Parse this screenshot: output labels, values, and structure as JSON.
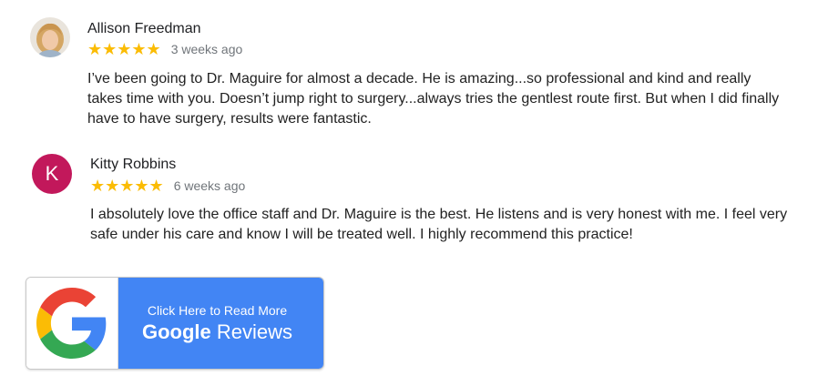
{
  "reviews": [
    {
      "name": "Allison Freedman",
      "stars": "★★★★★",
      "time": "3 weeks ago",
      "text": "I’ve been going to Dr. Maguire for almost a decade. He is amazing...so professional and kind and really takes time with you. Doesn’t jump right to surgery...always tries the gentlest route first. But when I did finally have to have surgery, results were fantastic.",
      "avatar_type": "photo"
    },
    {
      "name": "Kitty Robbins",
      "stars": "★★★★★",
      "time": "6 weeks ago",
      "text": "I absolutely love the office staff and Dr. Maguire is the best. He listens and is very honest with me. I feel very safe under his care and know I will be treated well. I highly recommend this practice!",
      "avatar_letter": "K",
      "avatar_color": "#c2185b"
    }
  ],
  "google_button": {
    "line1": "Click Here to Read More",
    "brand": "Google",
    "suffix": "Reviews",
    "panel_color": "#4285f4"
  },
  "colors": {
    "star": "#fbbc04",
    "time": "#70757a"
  }
}
